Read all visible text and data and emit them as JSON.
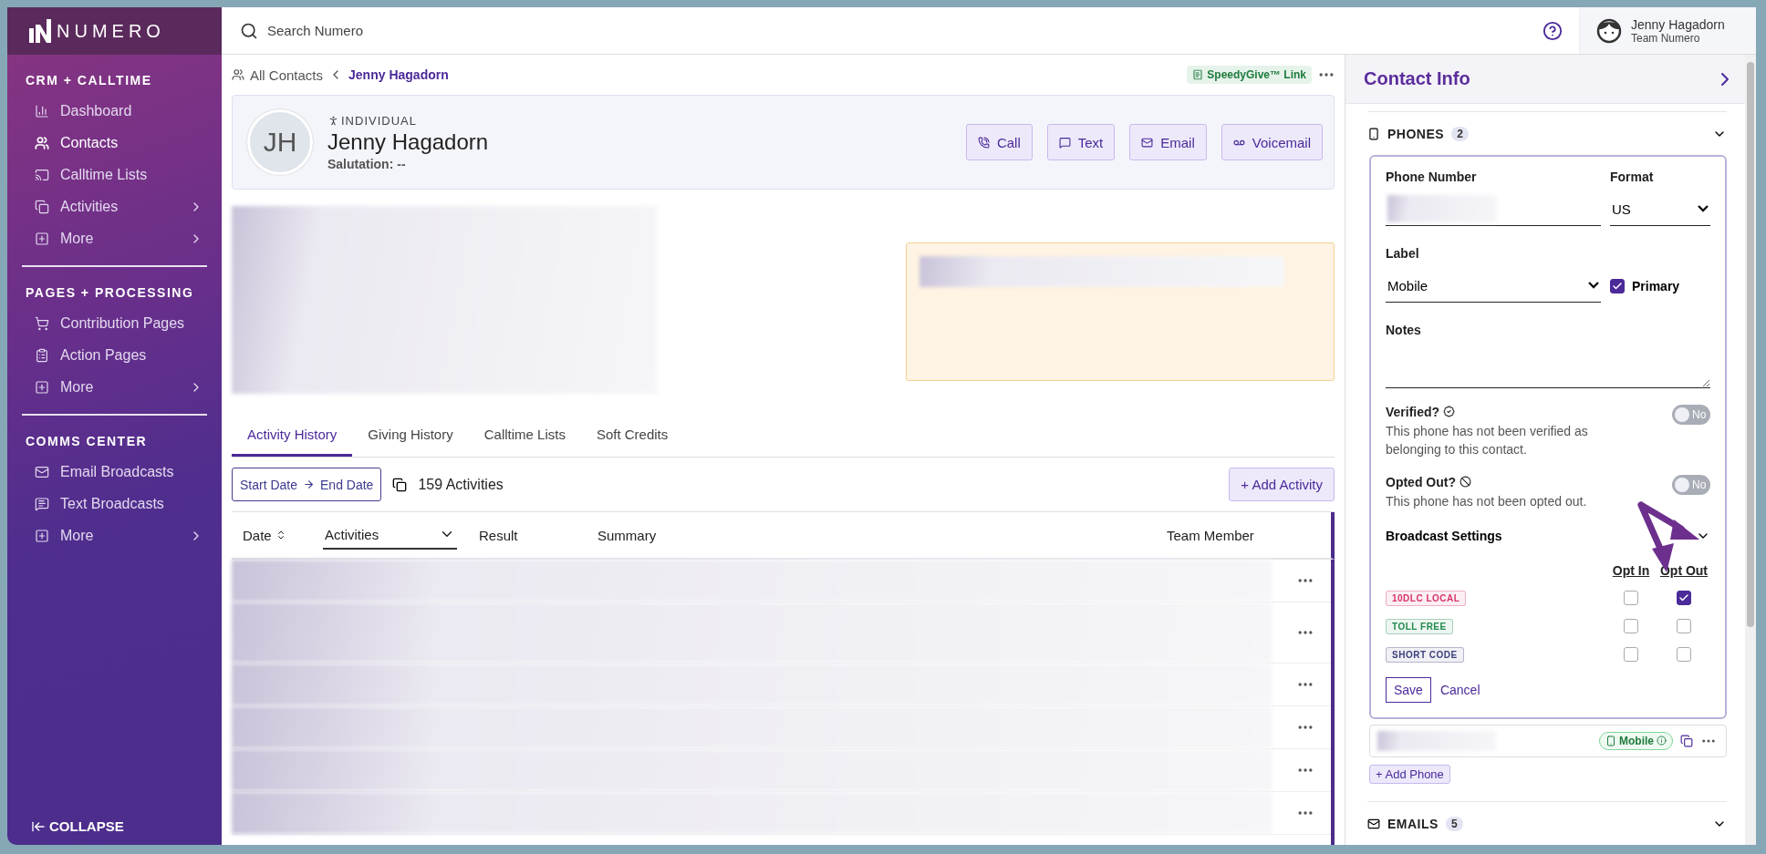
{
  "sidebar": {
    "logo": "NUMERO",
    "sections": [
      {
        "title": "CRM + CALLTIME",
        "items": [
          {
            "label": "Dashboard",
            "selected": false,
            "kind": "link"
          },
          {
            "label": "Contacts",
            "selected": true,
            "kind": "link"
          },
          {
            "label": "Calltime Lists",
            "selected": false,
            "kind": "link"
          },
          {
            "label": "Activities",
            "selected": false,
            "kind": "menu"
          },
          {
            "label": "More",
            "selected": false,
            "kind": "menu"
          }
        ]
      },
      {
        "title": "PAGES + PROCESSING",
        "items": [
          {
            "label": "Contribution Pages",
            "selected": false,
            "kind": "link"
          },
          {
            "label": "Action Pages",
            "selected": false,
            "kind": "link"
          },
          {
            "label": "More",
            "selected": false,
            "kind": "menu"
          }
        ]
      },
      {
        "title": "COMMS CENTER",
        "items": [
          {
            "label": "Email Broadcasts",
            "selected": false,
            "kind": "link"
          },
          {
            "label": "Text Broadcasts",
            "selected": false,
            "kind": "link"
          },
          {
            "label": "More",
            "selected": false,
            "kind": "menu"
          }
        ]
      }
    ],
    "collapse": "COLLAPSE"
  },
  "topbar": {
    "search": {
      "placeholder": "Search Numero"
    },
    "user": {
      "name": "Jenny Hagadorn",
      "team": "Team Numero"
    }
  },
  "breadcrumb": {
    "parent": "All Contacts",
    "current": "Jenny Hagadorn",
    "link_badge": "SpeedyGive™ Link"
  },
  "contact": {
    "initials": "JH",
    "type": "INDIVIDUAL",
    "name": "Jenny Hagadorn",
    "salutation": "Salutation: --",
    "actions": [
      "Call",
      "Text",
      "Email",
      "Voicemail"
    ]
  },
  "tabs": [
    {
      "label": "Activity History",
      "selected": true
    },
    {
      "label": "Giving History",
      "selected": false
    },
    {
      "label": "Calltime Lists",
      "selected": false
    },
    {
      "label": "Soft Credits",
      "selected": false
    }
  ],
  "toolbar": {
    "start_date": "Start Date",
    "end_date": "End Date",
    "count": "159 Activities",
    "add": "+ Add Activity"
  },
  "table": {
    "columns": [
      "Date",
      "Activities",
      "Result",
      "Summary",
      "Team Member"
    ],
    "rows": [
      {
        "kind": "redacted"
      },
      {
        "kind": "redacted"
      },
      {
        "kind": "redacted"
      },
      {
        "kind": "redacted"
      },
      {
        "kind": "redacted"
      },
      {
        "kind": "redacted"
      }
    ]
  },
  "contact_info": {
    "title": "Contact Info",
    "phones": {
      "title": "PHONES",
      "count": "2",
      "form": {
        "phone_label": "Phone Number",
        "format_label": "Format",
        "format_value": "US",
        "label_label": "Label",
        "label_value": "Mobile",
        "primary": {
          "label": "Primary",
          "checked": true
        },
        "notes_label": "Notes",
        "verified": {
          "title": "Verified?",
          "text": "This phone has not been verified as belonging to this contact.",
          "on": false,
          "toggle": "No"
        },
        "opted_out": {
          "title": "Opted Out?",
          "text": "This phone has not been opted out.",
          "on": false,
          "toggle": "No"
        },
        "broadcast": {
          "title": "Broadcast Settings",
          "opt_in": "Opt In",
          "opt_out": "Opt Out",
          "rows": [
            {
              "tag": "10DLC LOCAL",
              "color": "#d6336c",
              "opt_in": false,
              "opt_out": true
            },
            {
              "tag": "TOLL FREE",
              "color": "#1f8a4c",
              "opt_in": false,
              "opt_out": false
            },
            {
              "tag": "SHORT CODE",
              "color": "#3b3f7a",
              "opt_in": false,
              "opt_out": false
            }
          ]
        },
        "save": "Save",
        "cancel": "Cancel"
      },
      "other_phone": {
        "badge": "Mobile"
      },
      "add": "+ Add Phone"
    },
    "emails": {
      "title": "EMAILS",
      "count": "5"
    }
  }
}
